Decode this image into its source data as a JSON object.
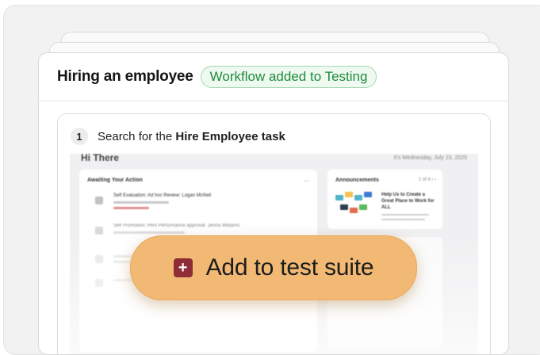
{
  "card": {
    "title": "Hiring an employee",
    "badge": "Workflow added to Testing"
  },
  "step": {
    "number": "1",
    "text_prefix": "Search for the ",
    "text_bold": "Hire Employee task"
  },
  "preview": {
    "greeting": "Hi There",
    "date": "It's Wednesday, July 23, 2025",
    "awaiting_title": "Awaiting Your Action",
    "awaiting_menu": "...",
    "item_1": "Self Evaluation: Ad hoc Review: Logan McNeil",
    "item_2": "Self Promotion: HR4 Performance approval: Jenna Williams",
    "announcements_title": "Announcements",
    "announcements_pager": "1 of 4   ‹   ›",
    "announcement_text": "Help Us to Create a Great Place to Work for ALL"
  },
  "cta": {
    "label": "Add to test suite",
    "icon": "plus-square-icon"
  },
  "colors": {
    "badge_green": "#1f8b3d",
    "cta_orange": "#f2b974",
    "cta_icon_bg": "#8e2d35"
  }
}
